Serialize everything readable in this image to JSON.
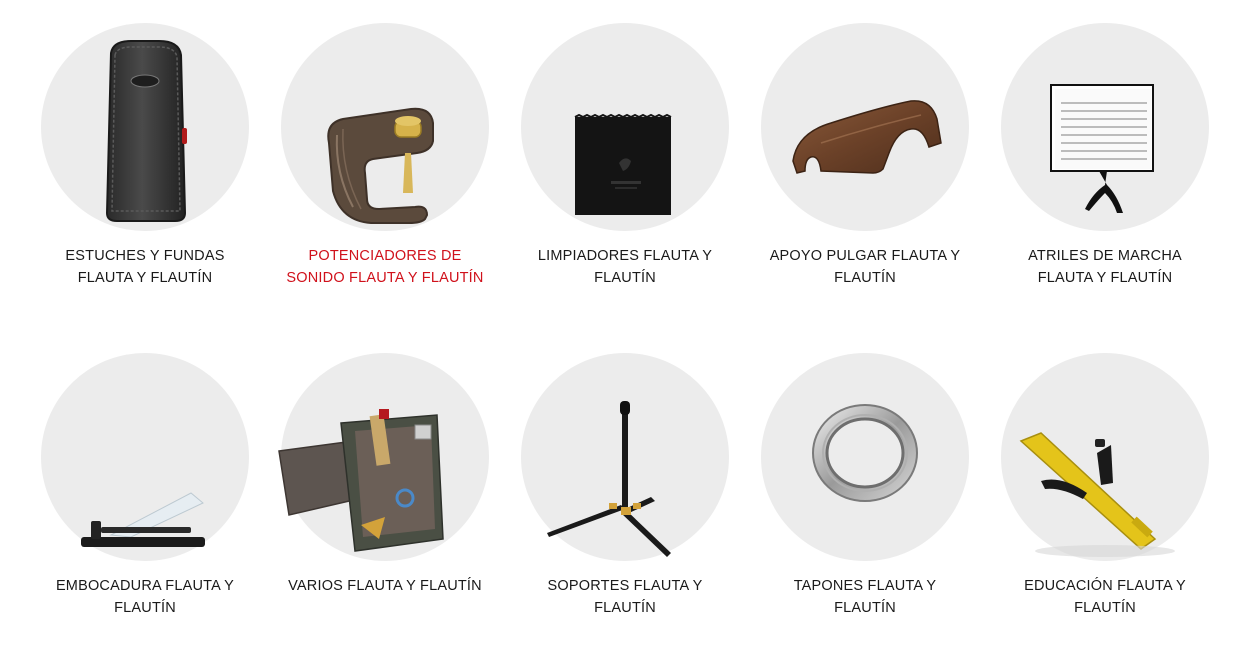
{
  "accent_color": "#d0111b",
  "categories": [
    {
      "label": "ESTUCHES Y FUNDAS FLAUTA Y FLAUTÍN",
      "image": "flute-case-image",
      "active": false
    },
    {
      "label": "POTENCIADORES DE SONIDO FLAUTA Y FLAUTÍN",
      "image": "sound-enhancer-image",
      "active": true
    },
    {
      "label": "LIMPIADORES FLAUTA Y FLAUTÍN",
      "image": "cleaning-cloth-image",
      "active": false
    },
    {
      "label": "APOYO PULGAR FLAUTA Y FLAUTÍN",
      "image": "thumb-rest-image",
      "active": false
    },
    {
      "label": "ATRILES DE MARCHA FLAUTA Y FLAUTÍN",
      "image": "marching-lyre-image",
      "active": false
    },
    {
      "label": "EMBOCADURA FLAUTA Y FLAUTÍN",
      "image": "embouchure-image",
      "active": false
    },
    {
      "label": "VARIOS FLAUTA Y FLAUTÍN",
      "image": "accessories-pouch-image",
      "active": false
    },
    {
      "label": "SOPORTES FLAUTA Y FLAUTÍN",
      "image": "flute-stand-image",
      "active": false
    },
    {
      "label": "TAPONES FLAUTA Y FLAUTÍN",
      "image": "flute-plug-ring-image",
      "active": false
    },
    {
      "label": "EDUCACIÓN FLAUTA Y FLAUTÍN",
      "image": "education-flute-image",
      "active": false
    }
  ]
}
